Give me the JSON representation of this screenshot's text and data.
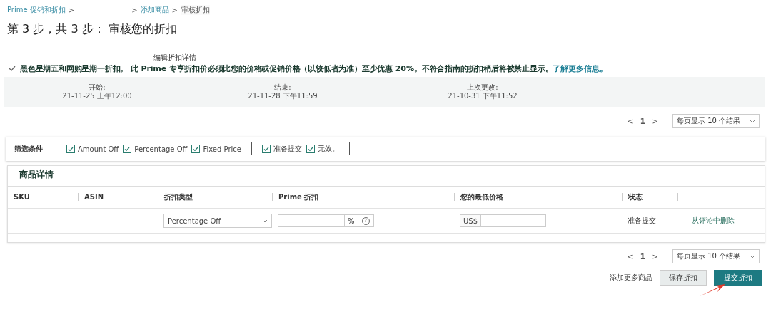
{
  "breadcrumbs": [
    {
      "label": "Prime 促销和折扣",
      "kind": "link"
    },
    {
      "label": ">",
      "kind": "sep"
    },
    {
      "label": ">",
      "kind": "sep"
    },
    {
      "label": "添加商品",
      "kind": "link"
    },
    {
      "label": ">",
      "kind": "sep"
    },
    {
      "label": "审核折扣",
      "kind": "current"
    }
  ],
  "title": "第 3 步，共 3 步：  审核您的折扣",
  "edit_link": "编辑折扣详情",
  "notice": {
    "text": "黑色星期五和网购星期一折扣。 此 Prime 专享折扣价必须比您的价格或促销价格（以较低者为准）至少优惠 20%。不符合指南的折扣稍后将被禁止显示。",
    "link": "了解更多信息。"
  },
  "dates": [
    {
      "label": "开始:",
      "value": "21-11-25 上午12:00"
    },
    {
      "label": "结束:",
      "value": "21-11-28 下午11:59"
    },
    {
      "label": "上次更改:",
      "value": "21-10-31 下午11:52"
    }
  ],
  "pagination_top": {
    "prev": "<",
    "page": "1",
    "next": ">",
    "page_size": "每页显示 10 个结果"
  },
  "filters": {
    "label": "筛选条件",
    "groups": [
      [
        {
          "label": "Amount Off",
          "checked": true
        },
        {
          "label": "Percentage Off",
          "checked": true
        },
        {
          "label": "Fixed Price",
          "checked": true
        }
      ],
      [
        {
          "label": "准备提交",
          "checked": true
        },
        {
          "label": "无效。",
          "checked": true
        }
      ]
    ]
  },
  "table": {
    "title": "商品详情",
    "columns": [
      "SKU",
      "ASIN",
      "折扣类型",
      "Prime 折扣",
      "您的最低价格",
      "状态"
    ],
    "rows": [
      {
        "sku": "",
        "asin": "",
        "discount_type": "Percentage Off",
        "discount_unit": "%",
        "help": "?",
        "currency": "US$",
        "status": "准备提交",
        "action": "从评论中删除"
      }
    ]
  },
  "pagination_bottom": {
    "prev": "<",
    "page": "1",
    "next": ">",
    "page_size": "每页显示 10 个结果"
  },
  "actions": {
    "add": "添加更多商品",
    "save": "保存折扣",
    "submit": "提交折扣"
  }
}
